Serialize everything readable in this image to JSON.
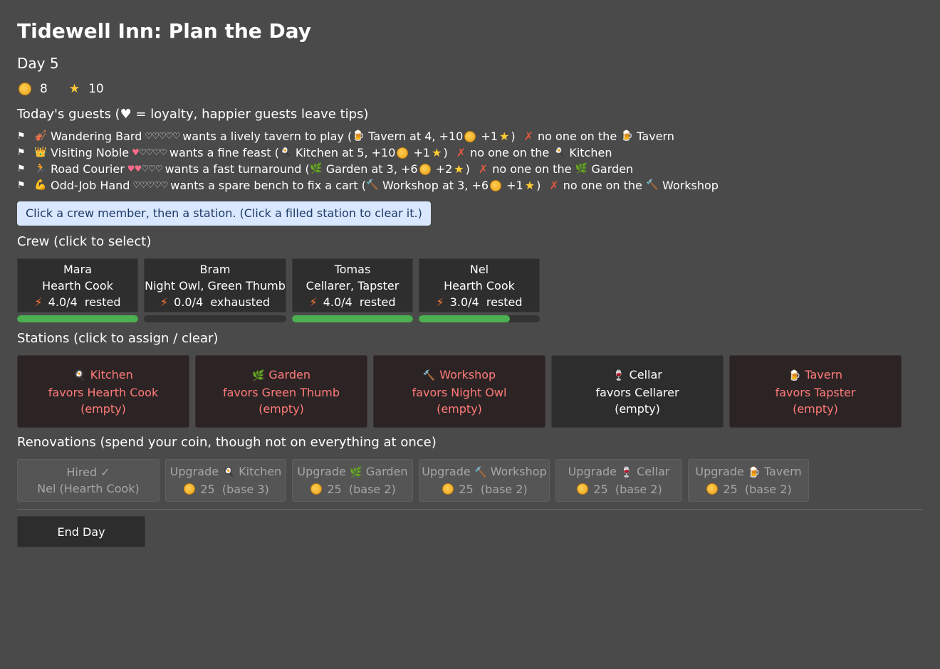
{
  "title": "Tidewell Inn: Plan the Day",
  "day": "Day 5",
  "resources": {
    "coins": "8",
    "stars": "10"
  },
  "guests_heading": "Today's guests  (♥ = loyalty, happier guests leave tips)",
  "guests": [
    {
      "icon": "🎻",
      "name": "Wandering Bard",
      "loyalty": 0,
      "want": "wants a lively tavern to play (",
      "station_icon": "🍺",
      "req": "Tavern at 4, +10",
      "star_text": "+1",
      "fail": "no one on the",
      "fail_icon": "🍺",
      "fail_station": "Tavern"
    },
    {
      "icon": "👑",
      "name": "Visiting Noble",
      "loyalty": 1,
      "want": "wants a fine feast (",
      "station_icon": "🍳",
      "req": "Kitchen at 5, +10",
      "star_text": "+1",
      "fail": "no one on the",
      "fail_icon": "🍳",
      "fail_station": "Kitchen"
    },
    {
      "icon": "🏃",
      "name": "Road Courier",
      "loyalty": 2,
      "want": "wants a fast turnaround (",
      "station_icon": "🌿",
      "req": "Garden at 3, +6",
      "star_text": "+2",
      "fail": "no one on the",
      "fail_icon": "🌿",
      "fail_station": "Garden"
    },
    {
      "icon": "💪",
      "name": "Odd-Job Hand",
      "loyalty": 0,
      "want": "wants a spare bench to fix a cart (",
      "station_icon": "🔨",
      "req": "Workshop at 3, +6",
      "star_text": "+1",
      "fail": "no one on the",
      "fail_icon": "🔨",
      "fail_station": "Workshop"
    }
  ],
  "hint": "Click a crew member, then a station.  (Click a filled station to clear it.)",
  "crew_heading": "Crew  (click to select)",
  "crew": [
    {
      "name": "Mara",
      "traits": "Hearth Cook",
      "energy": "4.0/4",
      "state": "rested",
      "energy_fraction": 1.0
    },
    {
      "name": "Bram",
      "traits": "Night Owl, Green Thumb",
      "energy": "0.0/4",
      "state": "exhausted",
      "energy_fraction": 0.0
    },
    {
      "name": "Tomas",
      "traits": "Cellarer, Tapster",
      "energy": "4.0/4",
      "state": "rested",
      "energy_fraction": 1.0
    },
    {
      "name": "Nel",
      "traits": "Hearth Cook",
      "energy": "3.0/4",
      "state": "rested",
      "energy_fraction": 0.75
    }
  ],
  "stations_heading": "Stations  (click to assign / clear)",
  "stations": [
    {
      "icon": "🍳",
      "name": "Kitchen",
      "favors": "favors Hearth Cook",
      "status": "(empty)"
    },
    {
      "icon": "🌿",
      "name": "Garden",
      "favors": "favors Green Thumb",
      "status": "(empty)"
    },
    {
      "icon": "🔨",
      "name": "Workshop",
      "favors": "favors Night Owl",
      "status": "(empty)"
    },
    {
      "icon": "🍷",
      "name": "Cellar",
      "favors": "favors Cellarer",
      "status": "(empty)"
    },
    {
      "icon": "🍺",
      "name": "Tavern",
      "favors": "favors Tapster",
      "status": "(empty)"
    }
  ],
  "renovations_heading": "Renovations  (spend your coin, though not on everything at once)",
  "hired": {
    "line1": "Hired ✓",
    "line2": "Nel (Hearth Cook)"
  },
  "upgrades": [
    {
      "prefix": "Upgrade",
      "icon": "🍳",
      "station": "Kitchen",
      "cost": "25",
      "base": "(base 3)"
    },
    {
      "prefix": "Upgrade",
      "icon": "🌿",
      "station": "Garden",
      "cost": "25",
      "base": "(base 2)"
    },
    {
      "prefix": "Upgrade",
      "icon": "🔨",
      "station": "Workshop",
      "cost": "25",
      "base": "(base 2)"
    },
    {
      "prefix": "Upgrade",
      "icon": "🍷",
      "station": "Cellar",
      "cost": "25",
      "base": "(base 2)"
    },
    {
      "prefix": "Upgrade",
      "icon": "🍺",
      "station": "Tavern",
      "cost": "25",
      "base": "(base 2)"
    }
  ],
  "end_day": "End Day"
}
